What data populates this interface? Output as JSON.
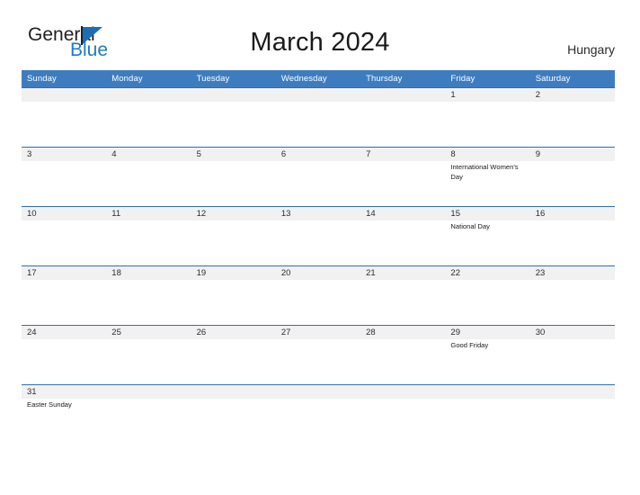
{
  "brand": {
    "name_part1": "General",
    "name_part2": "Blue",
    "accent_color": "#1f7ac4",
    "triangle_icon": "logo-triangle-icon"
  },
  "header": {
    "title": "March 2024",
    "country": "Hungary"
  },
  "calendar": {
    "month": "March",
    "year": "2024",
    "header_bg_color": "#3d7dbf",
    "row_border_color": "#2f6fb5",
    "day_band_color": "#f1f1f1",
    "weekday_headers": [
      "Sunday",
      "Monday",
      "Tuesday",
      "Wednesday",
      "Thursday",
      "Friday",
      "Saturday"
    ],
    "weeks": [
      [
        {
          "date": "",
          "events": []
        },
        {
          "date": "",
          "events": []
        },
        {
          "date": "",
          "events": []
        },
        {
          "date": "",
          "events": []
        },
        {
          "date": "",
          "events": []
        },
        {
          "date": "1",
          "events": []
        },
        {
          "date": "2",
          "events": []
        }
      ],
      [
        {
          "date": "3",
          "events": []
        },
        {
          "date": "4",
          "events": []
        },
        {
          "date": "5",
          "events": []
        },
        {
          "date": "6",
          "events": []
        },
        {
          "date": "7",
          "events": []
        },
        {
          "date": "8",
          "events": [
            "International Women's Day"
          ]
        },
        {
          "date": "9",
          "events": []
        }
      ],
      [
        {
          "date": "10",
          "events": []
        },
        {
          "date": "11",
          "events": []
        },
        {
          "date": "12",
          "events": []
        },
        {
          "date": "13",
          "events": []
        },
        {
          "date": "14",
          "events": []
        },
        {
          "date": "15",
          "events": [
            "National Day"
          ]
        },
        {
          "date": "16",
          "events": []
        }
      ],
      [
        {
          "date": "17",
          "events": []
        },
        {
          "date": "18",
          "events": []
        },
        {
          "date": "19",
          "events": []
        },
        {
          "date": "20",
          "events": []
        },
        {
          "date": "21",
          "events": []
        },
        {
          "date": "22",
          "events": []
        },
        {
          "date": "23",
          "events": []
        }
      ],
      [
        {
          "date": "24",
          "events": []
        },
        {
          "date": "25",
          "events": []
        },
        {
          "date": "26",
          "events": []
        },
        {
          "date": "27",
          "events": []
        },
        {
          "date": "28",
          "events": []
        },
        {
          "date": "29",
          "events": [
            "Good Friday"
          ]
        },
        {
          "date": "30",
          "events": []
        }
      ],
      [
        {
          "date": "31",
          "events": [
            "Easter Sunday"
          ]
        },
        {
          "date": "",
          "events": []
        },
        {
          "date": "",
          "events": []
        },
        {
          "date": "",
          "events": []
        },
        {
          "date": "",
          "events": []
        },
        {
          "date": "",
          "events": []
        },
        {
          "date": "",
          "events": []
        }
      ]
    ]
  }
}
